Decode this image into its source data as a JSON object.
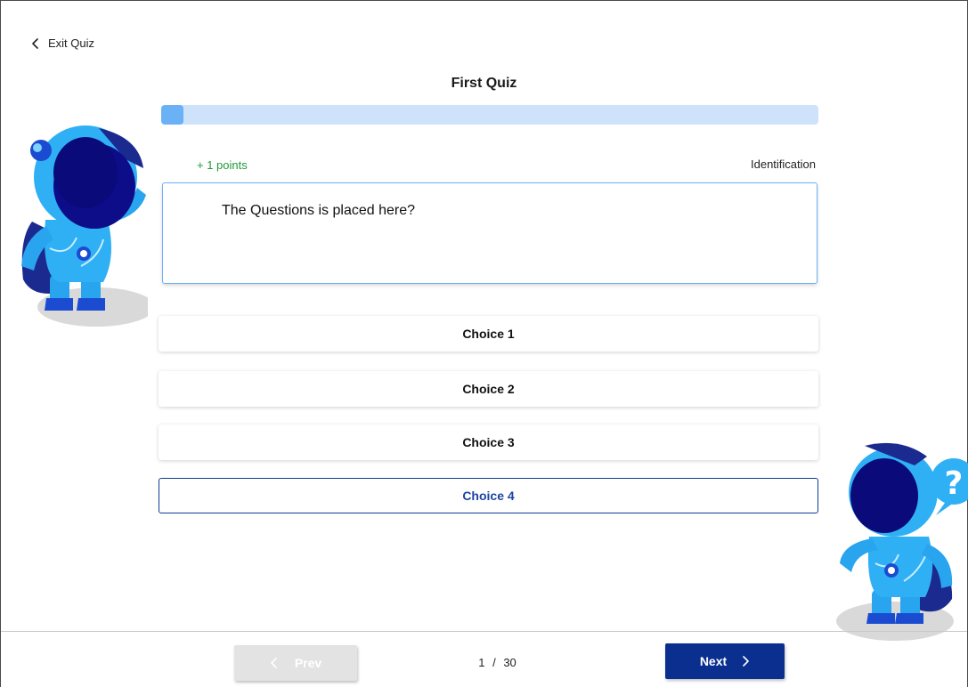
{
  "header": {
    "exit_label": "Exit Quiz",
    "title": "First Quiz"
  },
  "progress": {
    "fraction": 0.0333,
    "color_fill": "#6ab1f5",
    "color_track": "#cfe2fb"
  },
  "question": {
    "points": "+ 1 points",
    "type": "Identification",
    "text": "The Questions is placed here?"
  },
  "choices": [
    {
      "label": "Choice 1",
      "selected": false
    },
    {
      "label": "Choice 2",
      "selected": false
    },
    {
      "label": "Choice 3",
      "selected": false
    },
    {
      "label": "Choice 4",
      "selected": true
    }
  ],
  "footer": {
    "prev_label": "Prev",
    "next_label": "Next",
    "page_current": "1",
    "page_separator": "/",
    "page_total": "30"
  },
  "icons": {
    "back": "chevron-left-icon",
    "prev": "chevron-left-icon",
    "next": "chevron-right-icon"
  },
  "colors": {
    "accent": "#0a2f8f",
    "selected_text": "#1d45a3",
    "points_green": "#1f9a37"
  }
}
